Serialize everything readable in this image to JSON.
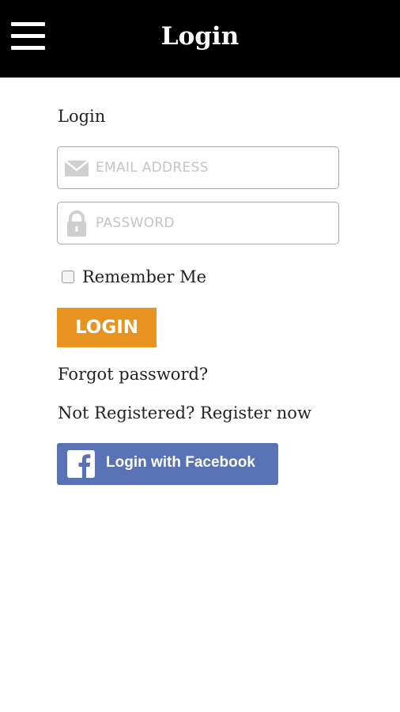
{
  "header": {
    "title": "Login",
    "menu_icon": "hamburger-menu-icon"
  },
  "form": {
    "section_label": "Login",
    "email": {
      "placeholder": "EMAIL ADDRESS",
      "value": "",
      "icon": "envelope-icon"
    },
    "password": {
      "placeholder": "PASSWORD",
      "value": "",
      "icon": "lock-icon"
    },
    "remember_label": "Remember Me",
    "remember_checked": false,
    "login_label": "LOGIN",
    "forgot_label": "Forgot password?",
    "register_prompt": "Not Registered?",
    "register_link": "Register now"
  },
  "facebook": {
    "label": "Login with Facebook",
    "icon": "facebook-icon"
  },
  "colors": {
    "topbar": "#000000",
    "login_button": "#e8921f",
    "facebook_button": "#5872b3"
  }
}
